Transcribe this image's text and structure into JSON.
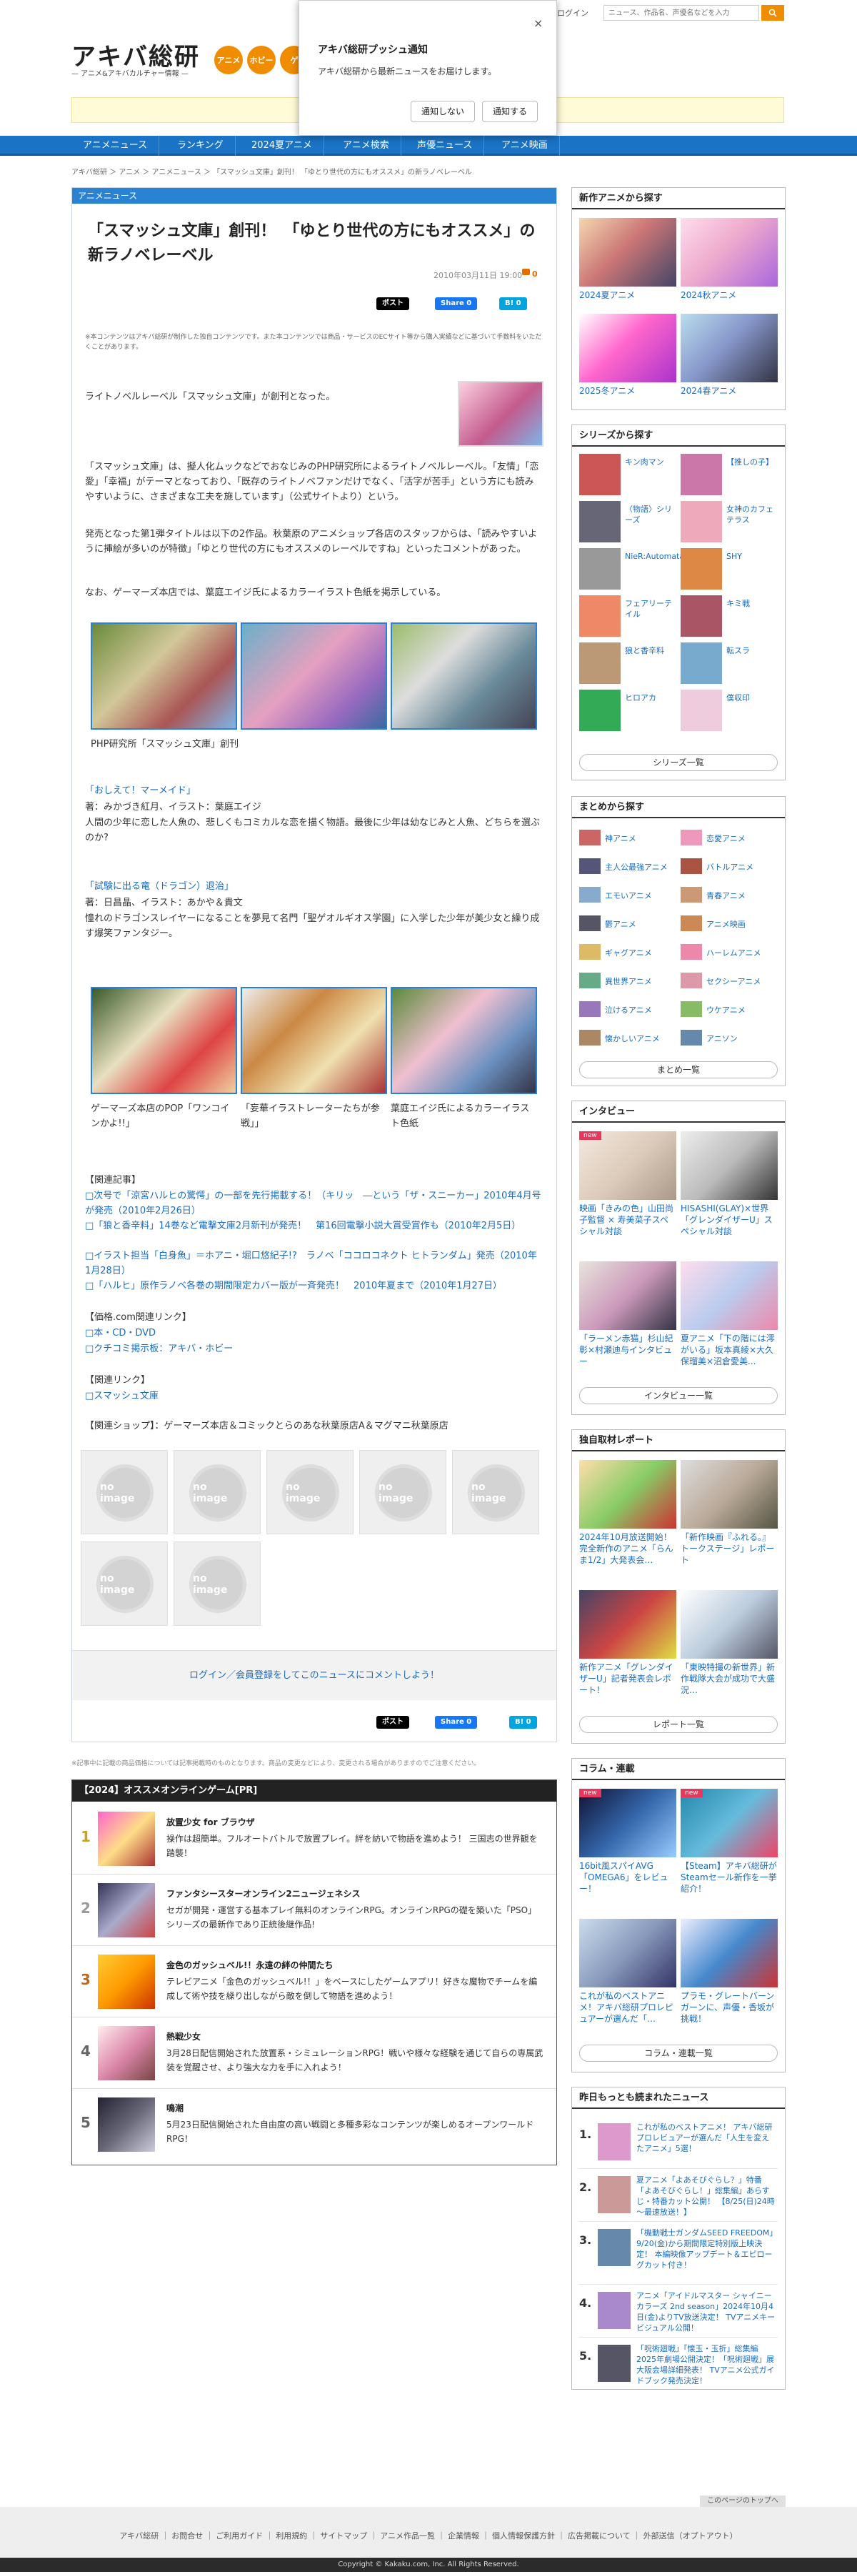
{
  "header": {
    "logo": "アキバ総研",
    "logo_sub": "— アニメ&アキバカルチャー情報 —",
    "bubbles": [
      {
        "label": "アニメ",
        "color": "#f08c00"
      },
      {
        "label": "ホビー",
        "color": "#f08c00"
      },
      {
        "label": "ゲ",
        "color": "#f08c00"
      }
    ],
    "login_link": "ログイン",
    "search_placeholder": "ニュース、作品名、声優名などを入力"
  },
  "popup": {
    "title": "アキバ総研プッシュ通知",
    "body": "アキバ総研から最新ニュースをお届けします。",
    "close": "×",
    "deny": "通知しない",
    "allow": "通知する"
  },
  "nav": [
    "アニメニュース",
    "ランキング",
    "2024夏アニメ",
    "アニメ検索",
    "声優ニュース",
    "アニメ映画"
  ],
  "breadcrumb": "アキバ総研 ＞ アニメ ＞ アニメニュース ＞ 「スマッシュ文庫」創刊！ 「ゆとり世代の方にもオススメ」の新ラノベレーベル",
  "article": {
    "section": "アニメニュース",
    "title": "「スマッシュ文庫」創刊！　「ゆとり世代の方にもオススメ」の新ラノベレーベル",
    "date": "2010年03月11日 19:00",
    "comments": "0",
    "share": {
      "post": "ポスト",
      "share": "Share 0",
      "hatena": "B! 0"
    },
    "notice": "※本コンテンツはアキバ総研が制作した独自コンテンツです。また本コンテンツでは商品・サービスのECサイト等から購入実績などに基づいて手数料をいただくことがあります。",
    "p1": "ライトノベルレーベル「スマッシュ文庫」が創刊となった。",
    "p2": "「スマッシュ文庫」は、擬人化ムックなどでおなじみのPHP研究所によるライトノベルレーベル。「友情」「恋愛」「幸福」がテーマとなっており、「既存のライトノベファンだけでなく、「活字が苦手」という方にも読みやすいように、さまざまな工夫を施しています」（公式サイトより）という。",
    "p3": "発売となった第1弾タイトルは以下の2作品。秋葉原のアニメショップ各店のスタッフからは、「読みやすいように挿絵が多いのが特徴」「ゆとり世代の方にもオススメのレーベルですね」といったコメントがあった。",
    "p4": "なお、ゲーマーズ本店では、葉庭エイジ氏によるカラーイラスト色紙を掲示している。",
    "caption1": "PHP研究所「スマッシュ文庫」創刊",
    "book1": {
      "title": "「おしえて！マーメイド」",
      "meta": "著：みかづき紅月、イラスト：葉庭エイジ",
      "desc": "人間の少年に恋した人魚の、悲しくもコミカルな恋を描く物語。最後に少年は幼なじみと人魚、どちらを選ぶのか?"
    },
    "book2": {
      "title": "「試験に出る竜（ドラゴン）退治」",
      "meta": "著：日昌晶、イラスト：あかや＆貴文",
      "desc": "憧れのドラゴンスレイヤーになることを夢見て名門「聖ゲオルギオス学園」に入学した少年が美少女と繰り成す爆笑ファンタジー。"
    },
    "caption2a": "ゲーマーズ本店のPOP「ワンコインかよ!!」",
    "caption2b": "「妄華イラストレーターたちが参戦」」",
    "caption2c": "葉庭エイジ氏によるカラーイラスト色紙",
    "related_head": "【関連記事】",
    "related": [
      "□次号で「涼宮ハルヒの驚愕」の一部を先行掲載する！（キリッ　―という「ザ・スニーカー」2010年4月号が発売（2010年2月26日）",
      "□「狼と香辛料」14巻など電撃文庫2月新刊が発売！　第16回電撃小説大賞受賞作も（2010年2月5日）",
      "□イラスト担当「白身魚」＝ホアニ・堀口悠紀子!?　ラノベ「ココロコネクト ヒトランダム」発売（2010年1月28日）",
      "□「ハルヒ」原作ラノベ各巻の期間限定カバー版が一斉発売！　2010年夏まで（2010年1月27日）"
    ],
    "price_head": "【価格.com関連リンク】",
    "price_links": [
      "□本・CD・DVD",
      "□クチコミ掲示板：アキバ・ホビー"
    ],
    "link_head": "【関連リンク】",
    "links": [
      "□スマッシュ文庫"
    ],
    "shop_line": "【関連ショップ】：ゲーマーズ本店＆コミックとらのあな秋葉原店A＆マグマニ秋葉原店",
    "noimage": "no image",
    "comment_cta": "ログイン／会員登録をしてこのニュースにコメントしよう！",
    "footnote": "※記事中に記載の商品価格については記事掲載時のものとなります。商品の変更などにより、変更される場合がありますのでご注意ください。"
  },
  "games": {
    "head": "【2024】オススメオンラインゲーム[PR]",
    "items": [
      {
        "rank": "1",
        "name": "放置少女 for ブラウザ",
        "desc": "操作は超簡単。フルオートバトルで放置プレイ。絆を紡いで物語を進めよう！ 三国志の世界観を踏襲！"
      },
      {
        "rank": "2",
        "name": "ファンタシースターオンライン2ニュージェネシス",
        "desc": "セガが開発・運営する基本プレイ無料のオンラインRPG。オンラインRPGの礎を築いた「PSO」シリーズの最新作であり正統後継作品!"
      },
      {
        "rank": "3",
        "name": "金色のガッシュベル!！永遠の絆の仲間たち",
        "desc": "テレビアニメ「金色のガッシュベル!！」をベースにしたゲームアプリ！好きな魔物でチームを編成して術や技を繰り出しながら敵を倒して物語を進めよう！"
      },
      {
        "rank": "4",
        "name": "熱戦少女",
        "desc": "3月28日配信開始された放置系・シミュレーションRPG！戦いや様々な経験を通じて自らの専属武装を覚醒させ、より強大な力を手に入れよう！"
      },
      {
        "rank": "5",
        "name": "鳴潮",
        "desc": "5月23日配信開始された自由度の高い戦闘と多種多彩なコンテンツが楽しめるオープンワールドRPG！"
      }
    ]
  },
  "sidebar": {
    "new_anime": {
      "head": "新作アニメから探す",
      "tiles": [
        "2024夏アニメ",
        "2024秋アニメ",
        "2025冬アニメ",
        "2024春アニメ"
      ]
    },
    "series": {
      "head": "シリーズから探す",
      "items": [
        "キン肉マン",
        "【推しの子】",
        "〈物語〉シリーズ",
        "女神のカフェテラス",
        "NieR:Automata",
        "SHY",
        "フェアリーテイル",
        "キミ戦",
        "狼と香辛料",
        "転スラ",
        "ヒロアカ",
        "僕収印"
      ],
      "more": "シリーズ一覧"
    },
    "matome": {
      "head": "まとめから探す",
      "items": [
        "神アニメ",
        "恋愛アニメ",
        "主人公最強アニメ",
        "バトルアニメ",
        "エモいアニメ",
        "青春アニメ",
        "鬱アニメ",
        "アニメ映画",
        "ギャグアニメ",
        "ハーレムアニメ",
        "異世界アニメ",
        "セクシーアニメ",
        "泣けるアニメ",
        "ウケアニメ",
        "懐かしいアニメ",
        "アニソン"
      ],
      "more": "まとめ一覧"
    },
    "interview": {
      "head": "インタビュー",
      "new_badge": "new",
      "tiles": [
        "映画「きみの色」山田尚子監督 × 寿美菜子スペシャル対談",
        "HISASHI(GLAY)×世界「グレンダイザーU」スペシャル対談",
        "「ラーメン赤猫」杉山紀彰×村瀬迪与インタビュー",
        "夏アニメ「下の階には澪がいる」坂本真綾×大久保瑠美×沼倉愛美..."
      ],
      "more": "インタビュー一覧"
    },
    "report": {
      "head": "独自取材レポート",
      "tiles": [
        "2024年10月放送開始！完全新作のアニメ「らんま1/2」大発表会…",
        "「新作映画『ふれる。』トークステージ」レポート",
        "新作アニメ「グレンダイザーU」記者発表会レポート！",
        "「東映特撮の新世界」新作戦隊大会が成功で大盛況…"
      ],
      "more": "レポート一覧"
    },
    "column": {
      "head": "コラム・連載",
      "new_badge": "new",
      "tiles": [
        "16bit風スパイAVG「OMEGA6」をレビュー！",
        "【Steam】アキバ総研がSteamセール新作を一挙紹介！",
        "これが私のベストアニメ！アキバ総研プロレビュアーが選んだ「…",
        "プラモ・グレートバーンガーンに、声優・香坂が挑戦！"
      ],
      "more": "コラム・連載一覧"
    },
    "hot": {
      "head": "昨日もっとも読まれたニュース",
      "items": [
        {
          "rank": "1.",
          "text": "これが私のベストアニメ！ アキバ総研プロレビュアーが選んだ「人生を変えたアニメ」5選！"
        },
        {
          "rank": "2.",
          "text": "夏アニメ「よあそびぐらし？」特番「よあそびぐらし！」総集編」あらすじ・特番カット公開！ 【8/25(日)24時～最速放送！】"
        },
        {
          "rank": "3.",
          "text": "「機動戦士ガンダムSEED FREEDOM」9/20(金)から期間限定特別版上映決定！ 本編映像アップデート＆エピローグカット付き！"
        },
        {
          "rank": "4.",
          "text": "アニメ「アイドルマスター シャイニーカラーズ 2nd season」2024年10月4日(金)よりTV放送決定！ TVアニメキービジュアル公開！"
        },
        {
          "rank": "5.",
          "text": "「呪術廻戦」「懐玉・玉折」総集編 2025年劇場公開決定！「呪術廻戦」展 大阪会場詳細発表！ TVアニメ公式ガイドブック発売決定！"
        }
      ]
    }
  },
  "footer": {
    "pagetop": "このページのトップへ",
    "links": "アキバ総研 ｜ お問合せ ｜ ご利用ガイド ｜ 利用規約 ｜ サイトマップ ｜ アニメ作品一覧 ｜ 企業情報 ｜ 個人情報保護方針 ｜ 広告掲載について ｜ 外部送信（オプトアウト）",
    "copyright": "Copyright © Kakaku.com, Inc. All Rights Reserved."
  }
}
